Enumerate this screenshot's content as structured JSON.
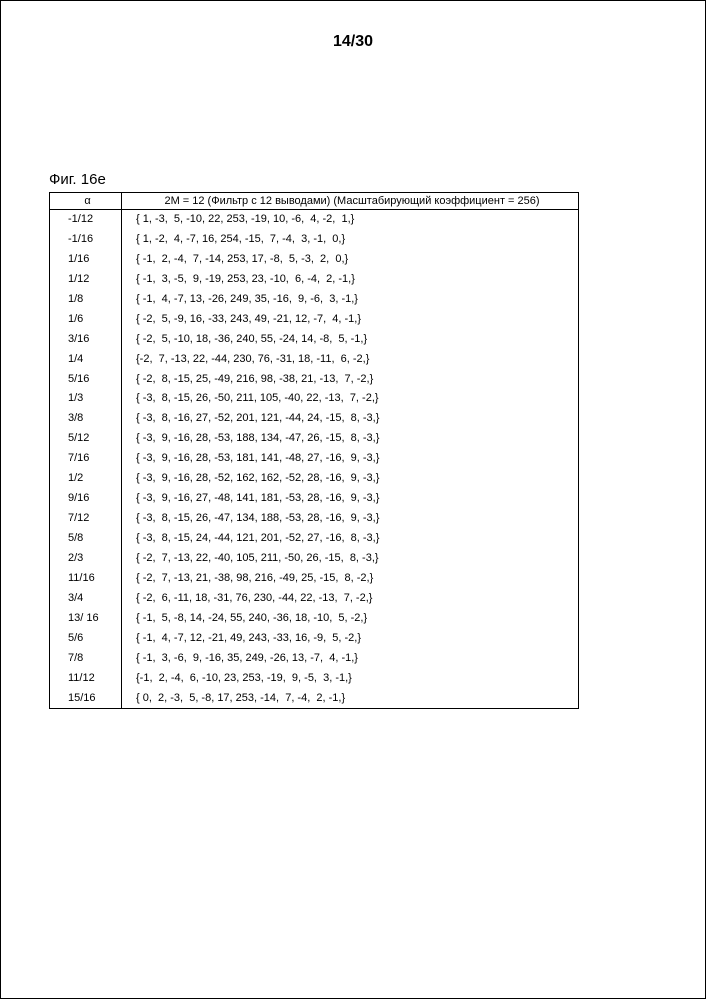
{
  "page_number": "14/30",
  "figure_label": "Фиг. 16е",
  "table": {
    "header_alpha": "α",
    "header_desc": "2M = 12 (Фильтр с 12 выводами) (Масштабирующий коэффициент = 256)",
    "rows": [
      {
        "alpha": "-1/12",
        "coef": "{ 1, -3,  5, -10, 22, 253, -19, 10, -6,  4, -2,  1,}"
      },
      {
        "alpha": "-1/16",
        "coef": "{ 1, -2,  4, -7, 16, 254, -15,  7, -4,  3, -1,  0,}"
      },
      {
        "alpha": "1/16",
        "coef": "{ -1,  2, -4,  7, -14, 253, 17, -8,  5, -3,  2,  0,}"
      },
      {
        "alpha": "1/12",
        "coef": "{ -1,  3, -5,  9, -19, 253, 23, -10,  6, -4,  2, -1,}"
      },
      {
        "alpha": "1/8",
        "coef": "{ -1,  4, -7, 13, -26, 249, 35, -16,  9, -6,  3, -1,}"
      },
      {
        "alpha": "1/6",
        "coef": "{ -2,  5, -9, 16, -33, 243, 49, -21, 12, -7,  4, -1,}"
      },
      {
        "alpha": "3/16",
        "coef": "{ -2,  5, -10, 18, -36, 240, 55, -24, 14, -8,  5, -1,}"
      },
      {
        "alpha": "1/4",
        "coef": "{-2,  7, -13, 22, -44, 230, 76, -31, 18, -11,  6, -2,}"
      },
      {
        "alpha": "5/16",
        "coef": "{ -2,  8, -15, 25, -49, 216, 98, -38, 21, -13,  7, -2,}"
      },
      {
        "alpha": "1/3",
        "coef": "{ -3,  8, -15, 26, -50, 211, 105, -40, 22, -13,  7, -2,}"
      },
      {
        "alpha": "3/8",
        "coef": "{ -3,  8, -16, 27, -52, 201, 121, -44, 24, -15,  8, -3,}"
      },
      {
        "alpha": "5/12",
        "coef": "{ -3,  9, -16, 28, -53, 188, 134, -47, 26, -15,  8, -3,}"
      },
      {
        "alpha": "7/16",
        "coef": "{ -3,  9, -16, 28, -53, 181, 141, -48, 27, -16,  9, -3,}"
      },
      {
        "alpha": "1/2",
        "coef": "{ -3,  9, -16, 28, -52, 162, 162, -52, 28, -16,  9, -3,}"
      },
      {
        "alpha": "9/16",
        "coef": "{ -3,  9, -16, 27, -48, 141, 181, -53, 28, -16,  9, -3,}"
      },
      {
        "alpha": "7/12",
        "coef": "{ -3,  8, -15, 26, -47, 134, 188, -53, 28, -16,  9, -3,}"
      },
      {
        "alpha": "5/8",
        "coef": "{ -3,  8, -15, 24, -44, 121, 201, -52, 27, -16,  8, -3,}"
      },
      {
        "alpha": "2/3",
        "coef": "{ -2,  7, -13, 22, -40, 105, 211, -50, 26, -15,  8, -3,}"
      },
      {
        "alpha": "11/16",
        "coef": "{ -2,  7, -13, 21, -38, 98, 216, -49, 25, -15,  8, -2,}"
      },
      {
        "alpha": "3/4",
        "coef": "{ -2,  6, -11, 18, -31, 76, 230, -44, 22, -13,  7, -2,}"
      },
      {
        "alpha": "13/ 16",
        "coef": "{ -1,  5, -8, 14, -24, 55, 240, -36, 18, -10,  5, -2,}"
      },
      {
        "alpha": "5/6",
        "coef": "{ -1,  4, -7, 12, -21, 49, 243, -33, 16, -9,  5, -2,}"
      },
      {
        "alpha": "7/8",
        "coef": "{ -1,  3, -6,  9, -16, 35, 249, -26, 13, -7,  4, -1,}"
      },
      {
        "alpha": "11/12",
        "coef": "{-1,  2, -4,  6, -10, 23, 253, -19,  9, -5,  3, -1,}"
      },
      {
        "alpha": "15/16",
        "coef": "{ 0,  2, -3,  5, -8, 17, 253, -14,  7, -4,  2, -1,}"
      }
    ]
  }
}
